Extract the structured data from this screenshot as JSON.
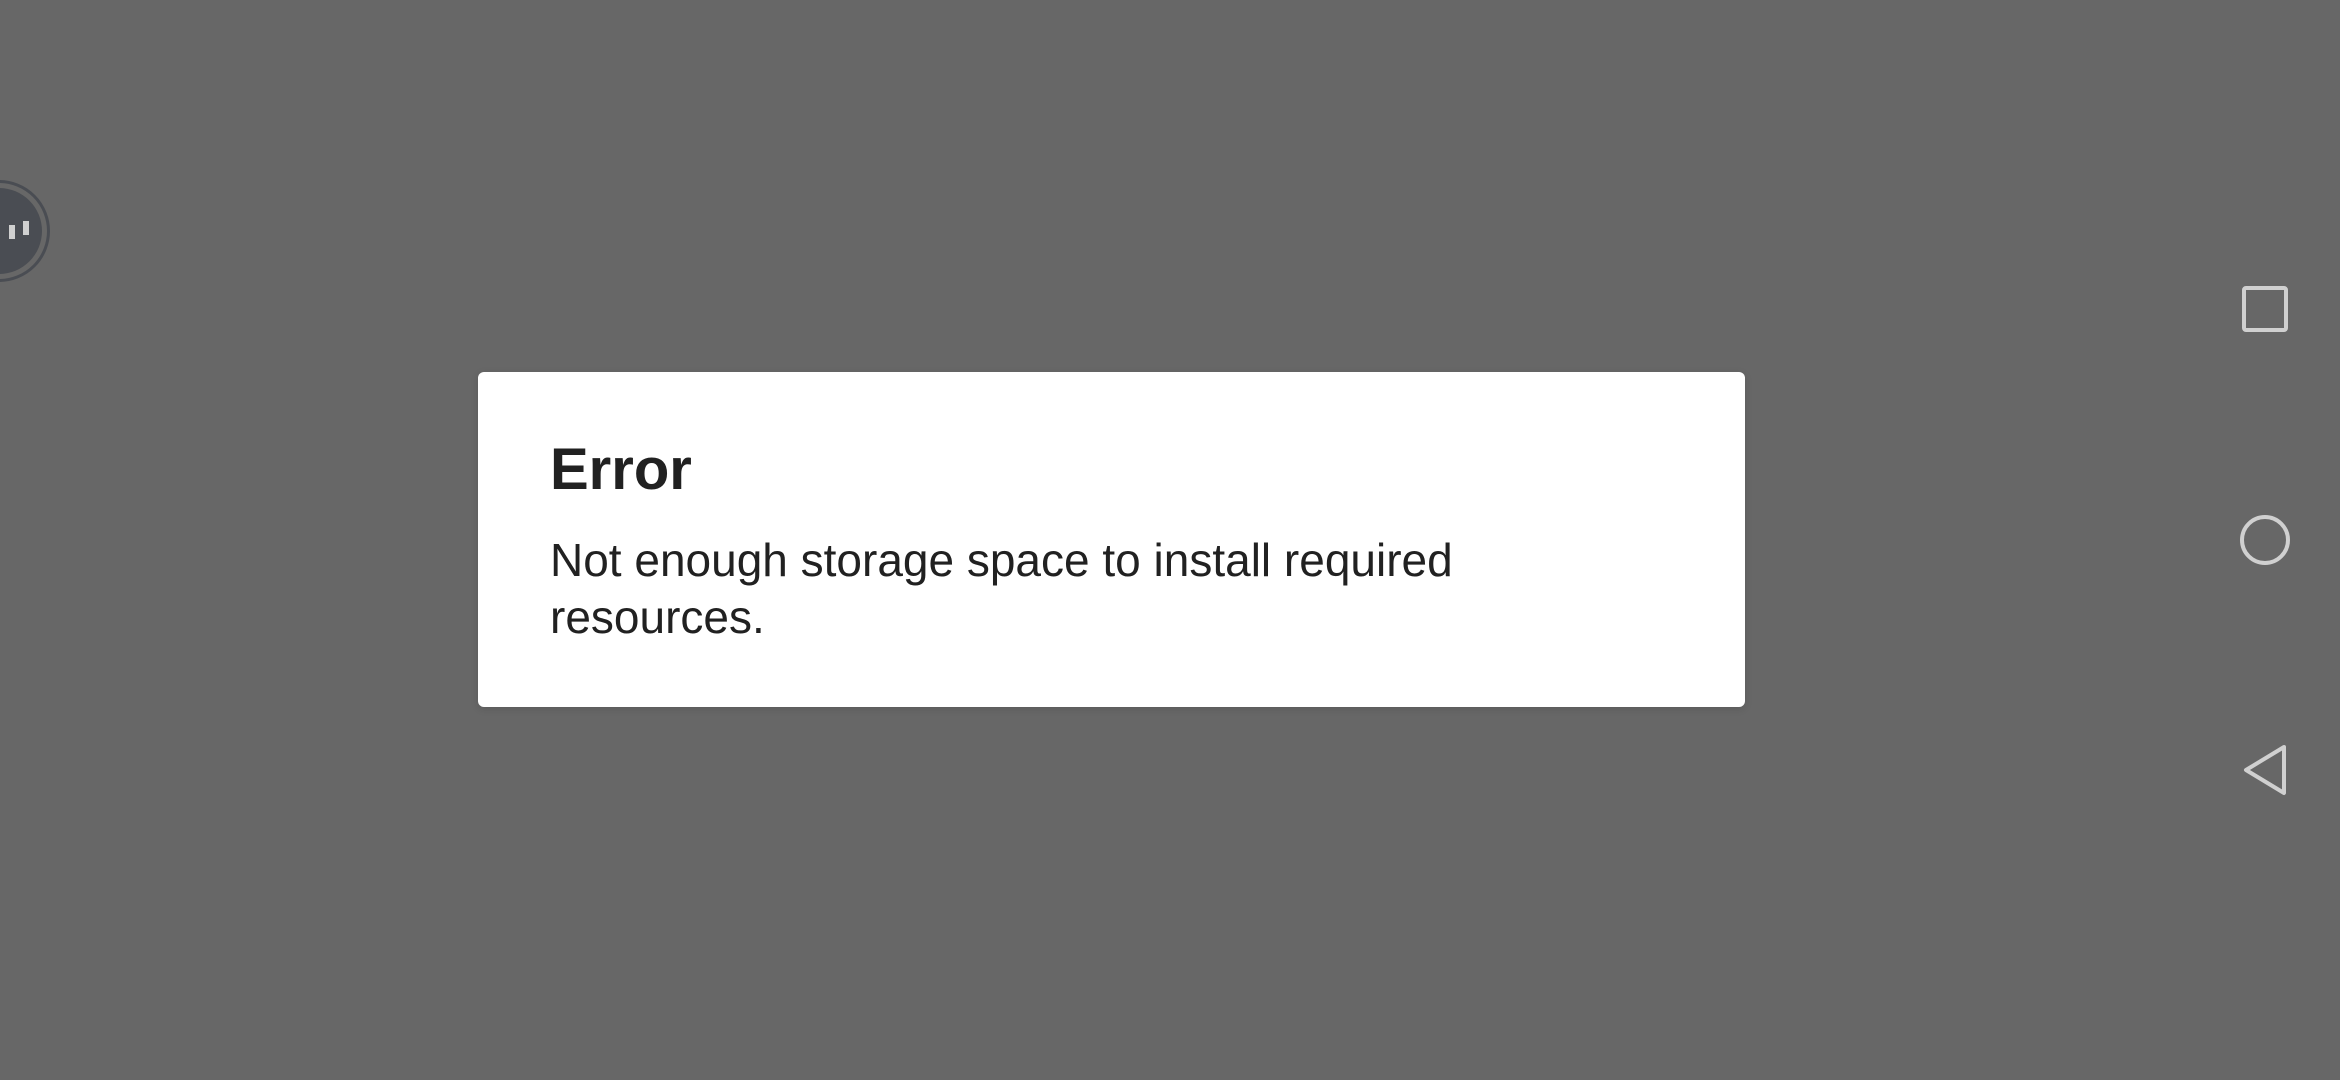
{
  "dialog": {
    "title": "Error",
    "message": "Not enough storage space to install required resources."
  },
  "icons": {
    "bubble": "floating-assistant-bubble-icon",
    "recents": "square-recents-icon",
    "home": "circle-home-icon",
    "back": "triangle-back-icon"
  },
  "colors": {
    "scrim": "#676767",
    "dialog_bg": "#ffffff",
    "text": "#212121",
    "nav_icon": "#d0d0d0",
    "bubble": "#4a4d53"
  }
}
